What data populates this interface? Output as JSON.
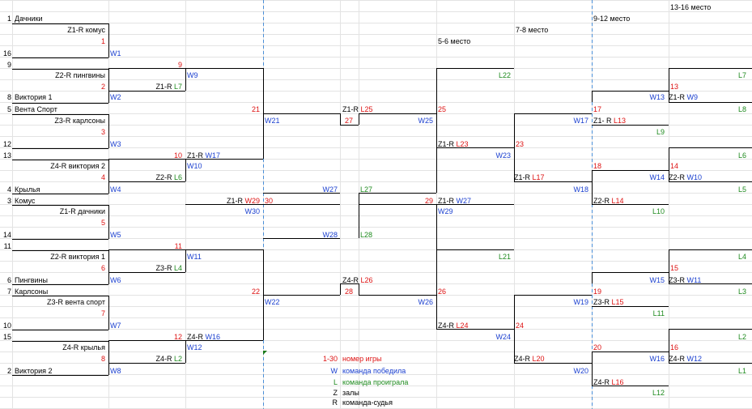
{
  "colors": {
    "red": "#dd1111",
    "blue": "#1a3fcf",
    "green": "#1e8a1e",
    "grid": "#e3e3e3",
    "dashed": "#4a8fd8"
  },
  "places": {
    "p13_16": "13-16 место",
    "p9_12": "9-12 место",
    "p7_8": "7-8 место",
    "p5_6": "5-6 место"
  },
  "rownums": [
    "1",
    "16",
    "9",
    "8",
    "5",
    "12",
    "13",
    "4",
    "3",
    "14",
    "11",
    "6",
    "7",
    "10",
    "15",
    "2"
  ],
  "teams": [
    "Дачники",
    "",
    "",
    "Виктория 1",
    "Вента Спорт",
    "",
    "",
    "Крылья",
    "Комус",
    "",
    "",
    "Пингвины",
    "Карлсоны",
    "",
    "",
    "Виктория 2"
  ],
  "r1": [
    {
      "hall": "Z1-R комус",
      "num": "1",
      "winner": "W1"
    },
    {
      "hall": "Z2-R пингвины",
      "num": "2",
      "winner": "W2"
    },
    {
      "hall": "Z3-R карлсоны",
      "num": "3",
      "winner": "W3"
    },
    {
      "hall": "Z4-R виктория 2",
      "num": "4",
      "winner": "W4"
    },
    {
      "hall": "Z1-R дачники",
      "num": "5",
      "winner": "W5"
    },
    {
      "hall": "Z2-R виктория 1",
      "num": "6",
      "winner": "W6"
    },
    {
      "hall": "Z3-R вента спорт",
      "num": "7",
      "winner": "W7"
    },
    {
      "hall": "Z4-R крылья",
      "num": "8",
      "winner": "W8"
    }
  ],
  "r2": [
    {
      "num": "9",
      "hall": "Z1-R",
      "ref": "L7",
      "winner": "W9"
    },
    {
      "num": "10",
      "hall": "Z2-R",
      "ref": "L6",
      "winner": "W10",
      "hall2": "Z1-R",
      "ref2": "W17"
    },
    {
      "num": "11",
      "hall": "Z3-R",
      "ref": "L4",
      "winner": "W11"
    },
    {
      "num": "12",
      "hall": "Z4-R",
      "ref": "L2",
      "winner": "W12",
      "hall2": "Z4-R",
      "ref2": "W16"
    }
  ],
  "r3": [
    {
      "num": "21",
      "winner": "W21"
    },
    {
      "hall": "Z1-R",
      "ref": "W29",
      "winner": "W30"
    },
    {
      "num": "22",
      "winner": "W22"
    }
  ],
  "r4": [
    {
      "num": "30",
      "winner": "W27",
      "loser": "L27"
    },
    {
      "winner": "W28",
      "loser": "L28"
    }
  ],
  "sf": [
    {
      "hall": "Z1-R",
      "ref": "L25",
      "num": "27"
    },
    {
      "hall": "Z4-R",
      "ref": "L26",
      "num": "28"
    }
  ],
  "r5": [
    {
      "winner": "W25",
      "num": "29",
      "hall": "Z1-R",
      "ref": "W27",
      "winner2": "W29"
    },
    {
      "winner": "W26"
    }
  ],
  "r6": [
    {
      "num": "25",
      "loser": "L22",
      "hall": "Z1-R",
      "ref": "L23",
      "winner": "W23"
    },
    {
      "num": "26",
      "loser": "L21",
      "hall": "Z4-R",
      "ref": "L24",
      "winner": "W24"
    }
  ],
  "r7": [
    {
      "winner": "W17",
      "num": "23",
      "hall": "Z1-R",
      "ref": "L17",
      "winner2": "W18"
    },
    {
      "winner": "W19",
      "num": "24",
      "hall": "Z4-R",
      "ref": "L20",
      "winner2": "W20"
    }
  ],
  "r8": [
    {
      "winner": "W13",
      "num": "17",
      "hall": "Z1- R",
      "ref": "L13",
      "loser": "L9",
      "num2": "18",
      "winner2": "W14",
      "hall2": "Z2-R",
      "ref2": "L14",
      "loser2": "L10"
    },
    {
      "winner": "W15",
      "num": "19",
      "hall": "Z3-R",
      "ref": "L15",
      "loser": "L11",
      "num2": "20",
      "winner2": "W16",
      "hall2": "Z4-R",
      "ref2": "L16",
      "loser2": "L12"
    }
  ],
  "r9": [
    {
      "loser": "L7",
      "num": "13",
      "hall": "Z1-R",
      "ref": "W9",
      "loser2": "L8"
    },
    {
      "loser": "L6",
      "num": "14",
      "hall": "Z2-R",
      "ref": "W10",
      "loser2": "L5"
    },
    {
      "loser": "L4",
      "num": "15",
      "hall": "Z3-R",
      "ref": "W11",
      "loser2": "L3"
    },
    {
      "loser": "L2",
      "num": "16",
      "hall": "Z4-R",
      "ref": "W12",
      "loser2": "L1"
    }
  ],
  "legend": {
    "num_key": "1-30",
    "num_text": "номер игры",
    "w_key": "W",
    "w_text": "команда победила",
    "l_key": "L",
    "l_text": "команда проиграла",
    "z_key": "Z",
    "z_text": "залы",
    "r_key": "R",
    "r_text": "команда-судья"
  }
}
